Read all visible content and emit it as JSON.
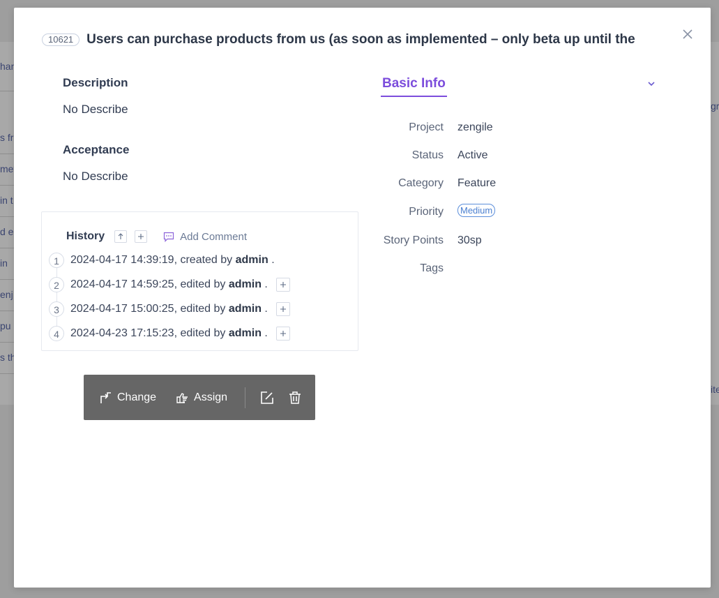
{
  "background": {
    "fragments": [
      "han",
      "s fro",
      "met",
      "in t",
      "d e",
      " in",
      "enj",
      " pu",
      "s th"
    ],
    "right_fragments": [
      "gr",
      "ite"
    ]
  },
  "story": {
    "id": "10621",
    "title": "Users can purchase products from us (as soon as implemented – only beta up until the"
  },
  "description": {
    "label": "Description",
    "value": "No Describe"
  },
  "acceptance": {
    "label": "Acceptance",
    "value": "No Describe"
  },
  "history": {
    "title": "History",
    "sort_icon": "arrow-up-icon",
    "expand_icon": "plus-icon",
    "add_comment": "Add Comment",
    "entries": [
      {
        "num": "1",
        "text": "2024-04-17 14:39:19, created by ",
        "user": "admin",
        "suffix": " .",
        "expandable": false
      },
      {
        "num": "2",
        "text": "2024-04-17 14:59:25, edited by ",
        "user": "admin",
        "suffix": " .",
        "expandable": true
      },
      {
        "num": "3",
        "text": "2024-04-17 15:00:25, edited by ",
        "user": "admin",
        "suffix": " .",
        "expandable": true
      },
      {
        "num": "4",
        "text": "2024-04-23 17:15:23, edited by ",
        "user": "admin",
        "suffix": " .",
        "expandable": true
      }
    ]
  },
  "basic_info": {
    "tab_label": "Basic Info",
    "fields": {
      "project": {
        "label": "Project",
        "value": "zengile"
      },
      "status": {
        "label": "Status",
        "value": "Active"
      },
      "category": {
        "label": "Category",
        "value": "Feature"
      },
      "priority": {
        "label": "Priority",
        "value": "Medium"
      },
      "story_points": {
        "label": "Story Points",
        "value": "30sp"
      },
      "tags": {
        "label": "Tags",
        "value": ""
      }
    }
  },
  "actions": {
    "change_label": "Change",
    "assign_label": "Assign",
    "edit_icon": "edit-icon",
    "delete_icon": "trash-icon"
  },
  "colors": {
    "accent": "#7c4ddc",
    "priority": "#4a7fd0",
    "action_bar": "#666666"
  }
}
